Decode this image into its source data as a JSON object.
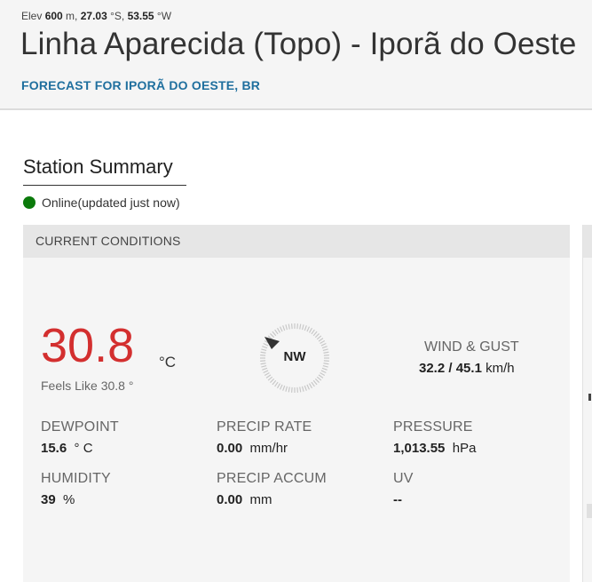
{
  "header": {
    "elev_prefix": "Elev ",
    "elev_value": "600",
    "elev_unit": " m, ",
    "lat_value": "27.03",
    "lat_unit": " °S, ",
    "lon_value": "53.55",
    "lon_unit": " °W",
    "title": "Linha Aparecida (Topo) - Iporã do Oeste",
    "forecast_link": "FORECAST FOR IPORÃ DO OESTE, BR"
  },
  "summary": {
    "title": "Station Summary",
    "status_text": "Online(updated just now)",
    "status_color": "#0b7a0b"
  },
  "conditions": {
    "header": "CURRENT CONDITIONS",
    "temperature": "30.8",
    "temperature_unit": "°C",
    "feels_like": "Feels Like 30.8 °",
    "temperature_color": "#d32f2f",
    "wind_direction": "NW",
    "wind_label": "WIND & GUST",
    "wind_speed": "32.2",
    "wind_separator": " / ",
    "wind_gust": "45.1",
    "wind_unit": " km/h",
    "dewpoint_label": "DEWPOINT",
    "dewpoint_value": "15.6",
    "dewpoint_unit": "° C",
    "precip_rate_label": "PRECIP RATE",
    "precip_rate_value": "0.00",
    "precip_rate_unit": "mm/hr",
    "pressure_label": "PRESSURE",
    "pressure_value": "1,013.55",
    "pressure_unit": "hPa",
    "humidity_label": "HUMIDITY",
    "humidity_value": "39",
    "humidity_unit": "%",
    "precip_accum_label": "PRECIP ACCUM",
    "precip_accum_value": "0.00",
    "precip_accum_unit": "mm",
    "uv_label": "UV",
    "uv_value": "--"
  },
  "icons": {
    "status": "status-dot-icon",
    "compass": "compass-dial-icon"
  }
}
